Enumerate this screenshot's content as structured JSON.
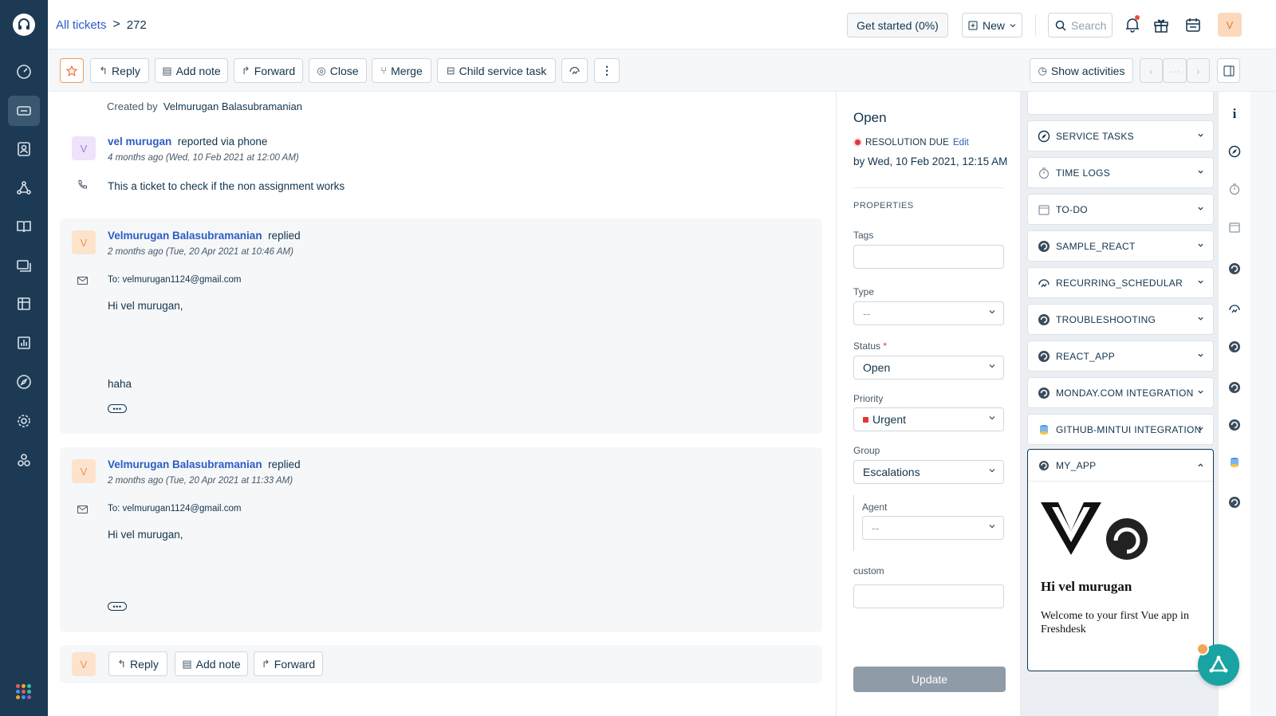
{
  "breadcrumb": {
    "parent": "All tickets",
    "separator": ">",
    "current": "272"
  },
  "topbar": {
    "get_started": "Get started (0%)",
    "new_label": "New",
    "search_placeholder": "Search",
    "avatar_initial": "V"
  },
  "toolbar": {
    "reply": "Reply",
    "add_note": "Add note",
    "forward": "Forward",
    "close": "Close",
    "merge": "Merge",
    "child_task": "Child service task",
    "show_activities": "Show activities",
    "pager_middle": "···"
  },
  "conversation": {
    "created_by_label": "Created by",
    "created_by_name": "Velmurugan Balasubramanian",
    "origin": {
      "avatar": "V",
      "name": "vel murugan",
      "action": "reported via phone",
      "time": "4 months ago (Wed, 10 Feb 2021 at 12:00 AM)",
      "body": "This a ticket to check if the non assignment works"
    },
    "replies": [
      {
        "avatar": "V",
        "name": "Velmurugan Balasubramanian",
        "action": "replied",
        "time": "2 months ago (Tue, 20 Apr 2021 at 10:46 AM)",
        "to": "To: velmurugan1124@gmail.com",
        "greeting": "Hi vel murugan,",
        "body": "haha",
        "more": "•••"
      },
      {
        "avatar": "V",
        "name": "Velmurugan Balasubramanian",
        "action": "replied",
        "time": "2 months ago (Tue, 20 Apr 2021 at 11:33 AM)",
        "to": "To: velmurugan1124@gmail.com",
        "greeting": "Hi vel murugan,",
        "more": "•••"
      }
    ],
    "footer": {
      "avatar": "V",
      "reply": "Reply",
      "add_note": "Add note",
      "forward": "Forward"
    }
  },
  "properties": {
    "status_title": "Open",
    "resolution_label": "RESOLUTION DUE",
    "edit": "Edit",
    "due_date": "by Wed, 10 Feb 2021, 12:15 AM",
    "section_title": "PROPERTIES",
    "tags_label": "Tags",
    "type_label": "Type",
    "type_value": "--",
    "status_label": "Status",
    "required_mark": "*",
    "status_value": "Open",
    "priority_label": "Priority",
    "priority_value": "Urgent",
    "priority_color": "#e43538",
    "group_label": "Group",
    "group_value": "Escalations",
    "agent_label": "Agent",
    "agent_value": "--",
    "custom_label": "custom",
    "update": "Update"
  },
  "apps": {
    "items": [
      {
        "label": "SERVICE TASKS",
        "icon": "compass-icon"
      },
      {
        "label": "TIME LOGS",
        "icon": "stopwatch-icon"
      },
      {
        "label": "TO-DO",
        "icon": "calendar-icon"
      },
      {
        "label": "SAMPLE_REACT",
        "icon": "app-swirl-icon"
      },
      {
        "label": "RECURRING_SCHEDULAR",
        "icon": "recurring-icon"
      },
      {
        "label": "TROUBLESHOOTING",
        "icon": "app-swirl-icon"
      },
      {
        "label": "REACT_APP",
        "icon": "app-swirl-icon"
      },
      {
        "label": "MONDAY.COM INTEGRATION",
        "icon": "app-swirl-icon"
      },
      {
        "label": "GITHUB-MINTUI INTEGRATION",
        "icon": "db-icon"
      }
    ],
    "my_app": {
      "label": "MY_APP",
      "greeting": "Hi vel murugan",
      "message": "Welcome to your first Vue app in Freshdesk"
    }
  },
  "colors": {
    "nav_bg": "#1d3a54",
    "link": "#2c5cc5",
    "accent_orange": "#f49a56",
    "fab": "#1aa3a3"
  }
}
